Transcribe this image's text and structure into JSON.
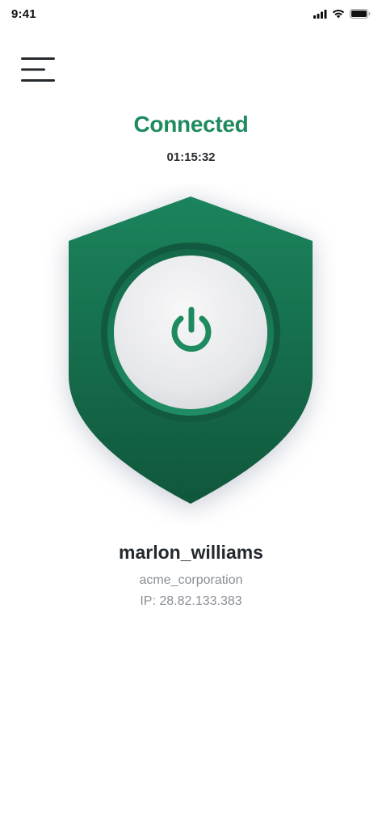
{
  "status_bar": {
    "time": "9:41",
    "icons": [
      "signal-icon",
      "wifi-icon",
      "battery-icon"
    ]
  },
  "menu": {
    "icon": "hamburger-menu-icon"
  },
  "connection": {
    "status": "Connected",
    "duration": "01:15:32"
  },
  "shield": {
    "icon": "shield-icon",
    "power_icon": "power-icon"
  },
  "user": {
    "username": "marlon_williams",
    "organization": "acme_corporation",
    "ip_label": "IP:",
    "ip_address": "28.82.133.383"
  },
  "colors": {
    "accent": "#1e8a5e",
    "shield_top": "#1b845c",
    "shield_bottom": "#10573b",
    "ring": "#1f8a61",
    "button_face": "#ececee",
    "muted_text": "#8a8f96"
  }
}
